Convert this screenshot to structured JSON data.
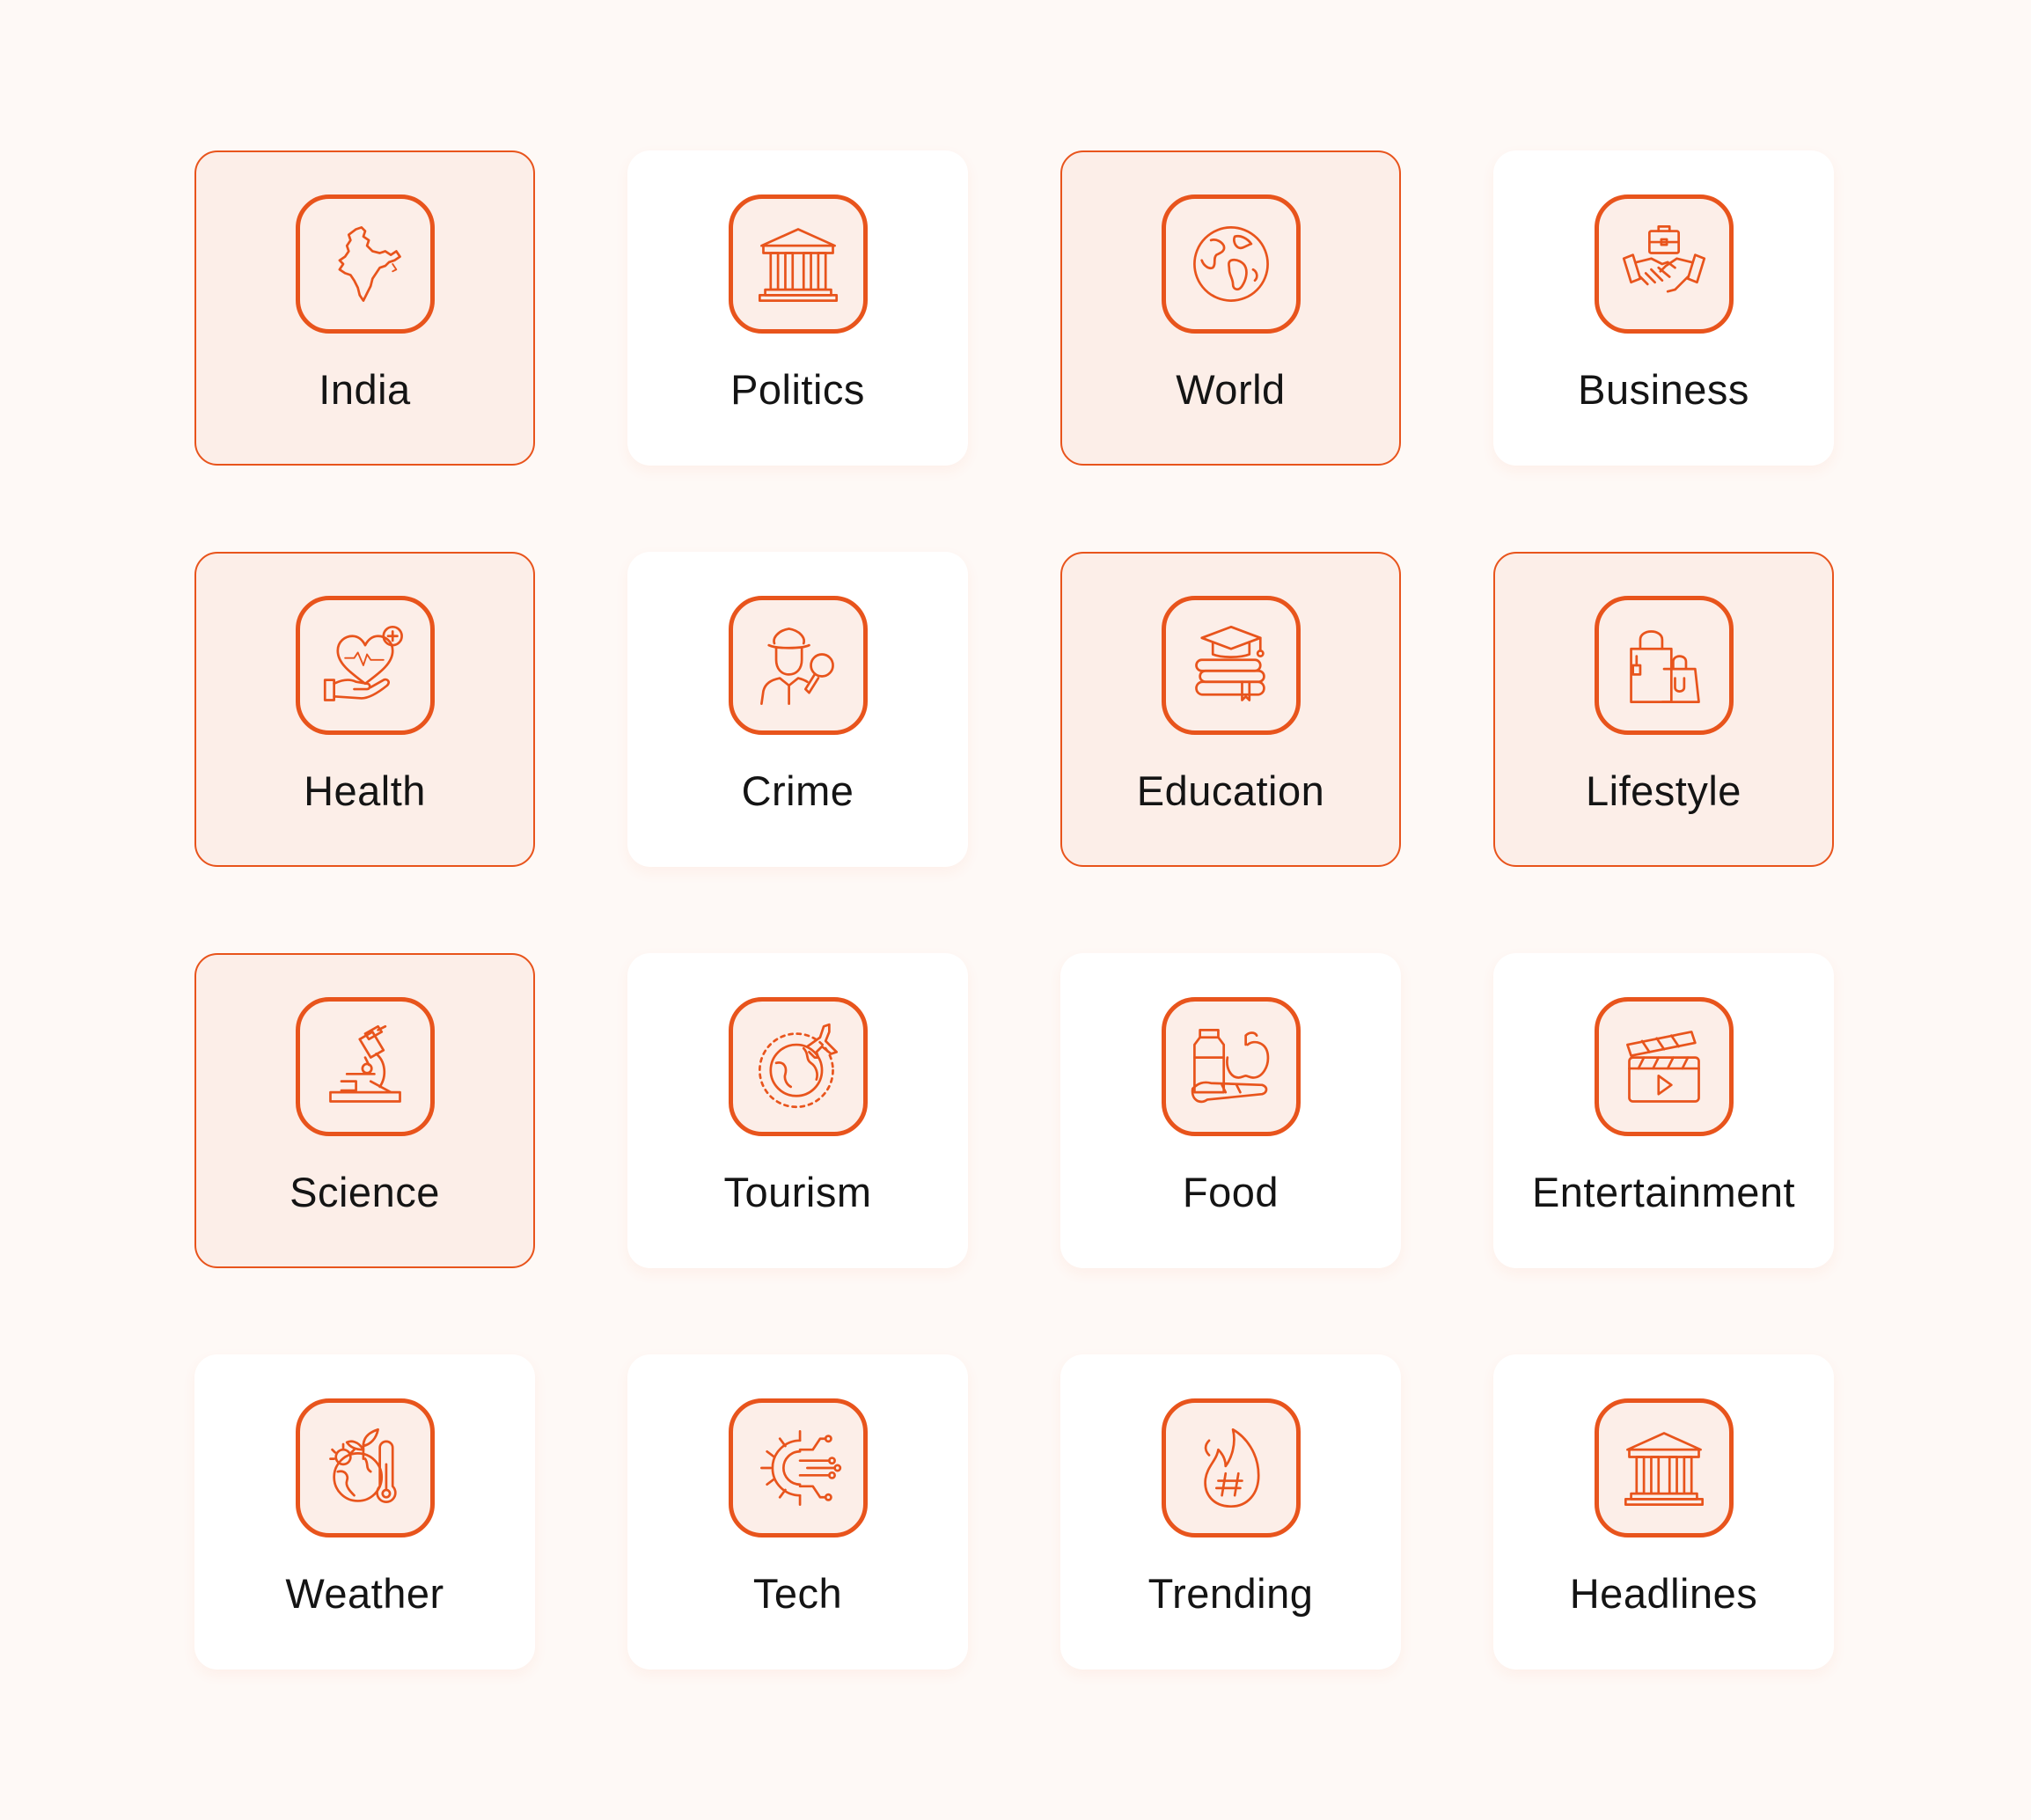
{
  "accent_color": "#E8541C",
  "selected_background": "#FCEEE8",
  "categories": [
    {
      "label": "India",
      "icon": "india-map-icon",
      "selected": true
    },
    {
      "label": "Politics",
      "icon": "government-building-icon",
      "selected": false
    },
    {
      "label": "World",
      "icon": "globe-icon",
      "selected": true
    },
    {
      "label": "Business",
      "icon": "handshake-briefcase-icon",
      "selected": false
    },
    {
      "label": "Health",
      "icon": "heart-in-hand-icon",
      "selected": true
    },
    {
      "label": "Crime",
      "icon": "detective-icon",
      "selected": false
    },
    {
      "label": "Education",
      "icon": "graduation-cap-books-icon",
      "selected": true
    },
    {
      "label": "Lifestyle",
      "icon": "shopping-bags-icon",
      "selected": true
    },
    {
      "label": "Science",
      "icon": "microscope-icon",
      "selected": true
    },
    {
      "label": "Tourism",
      "icon": "globe-airplane-icon",
      "selected": false
    },
    {
      "label": "Food",
      "icon": "groceries-icon",
      "selected": false
    },
    {
      "label": "Entertainment",
      "icon": "clapperboard-icon",
      "selected": false
    },
    {
      "label": "Weather",
      "icon": "earth-thermometer-icon",
      "selected": false
    },
    {
      "label": "Tech",
      "icon": "gear-circuit-icon",
      "selected": false
    },
    {
      "label": "Trending",
      "icon": "fire-hashtag-icon",
      "selected": false
    },
    {
      "label": "Headlines",
      "icon": "government-building-icon",
      "selected": false
    }
  ]
}
